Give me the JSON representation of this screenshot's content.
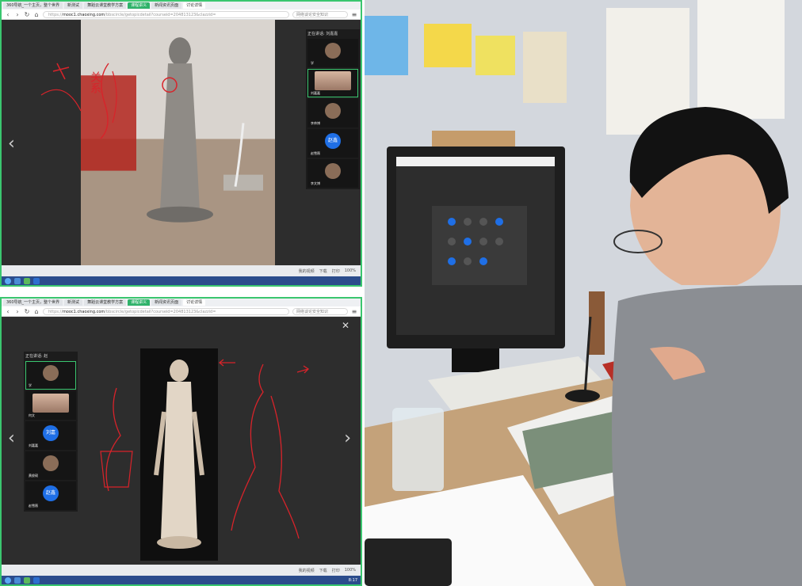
{
  "browser": {
    "tabs": [
      {
        "label": "360导航_一个主页，整个世界"
      },
      {
        "label": "新测试"
      },
      {
        "label": "舞蹈云课堂教学方案"
      },
      {
        "label": "课程讲义"
      },
      {
        "label": "新闻资讯页面"
      },
      {
        "label": "讨论详情"
      }
    ],
    "url_prefix": "https://",
    "url_host": "mooc1.chaoxing.com",
    "url_path": "/bbscircle/getopicdetail?courseid=204813123&clazzid=",
    "search_placeholder": "网络谈论安全知识"
  },
  "top_panel": {
    "strip_title": "正在讲话: 刘嘉嘉",
    "participants": [
      {
        "name": "学",
        "kind": "avatar"
      },
      {
        "name": "刘嘉嘉",
        "kind": "video"
      },
      {
        "name": "李帅博",
        "kind": "avatar"
      },
      {
        "name": "赵雪薇",
        "kind": "blue",
        "badge": "赵鑫"
      },
      {
        "name": "李文博",
        "kind": "avatar"
      }
    ],
    "sketch_note": "关系",
    "status_items": [
      "我的视频",
      "下载",
      "打印",
      "100%"
    ]
  },
  "bottom_panel": {
    "strip_title": "正在讲话: 赵",
    "participants": [
      {
        "name": "学",
        "kind": "avatar"
      },
      {
        "name": "何文",
        "kind": "video"
      },
      {
        "name": "刘嘉嘉",
        "kind": "blue",
        "badge": "刘嘉"
      },
      {
        "name": "黄俊硕",
        "kind": "avatar"
      },
      {
        "name": "赵雪薇",
        "kind": "blue",
        "badge": "赵鑫"
      }
    ],
    "close_icon": "close-icon",
    "status_items": [
      "我的视频",
      "下载",
      "打印",
      "100%"
    ],
    "clock": "8:17"
  },
  "colors": {
    "accent_green": "#3ac66f",
    "dark_bg": "#2b2b2b",
    "avatar_blue": "#1f6fe6",
    "sketch_red": "#d8232a"
  }
}
